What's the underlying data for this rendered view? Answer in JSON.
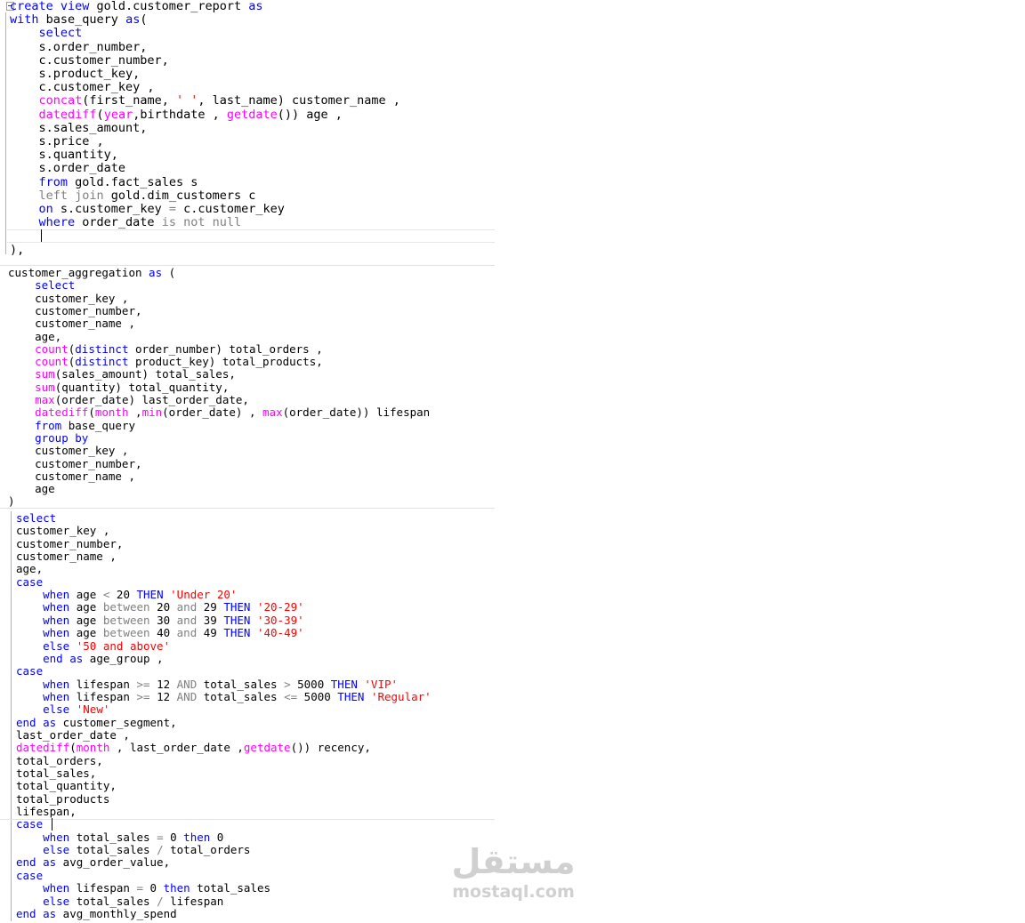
{
  "editor": {
    "language": "sql",
    "palette": {
      "keyword": "#0000ff",
      "function": "#ff00ff",
      "string": "#ff0000",
      "operator": "#808080",
      "text": "#000000",
      "background": "#ffffff"
    },
    "panels": [
      {
        "id": "p1",
        "lines": [
          [
            [
              "kw",
              "create view"
            ],
            [
              "",
              " gold.customer_report "
            ],
            [
              "kw",
              "as"
            ]
          ],
          [
            [
              "kw",
              "with"
            ],
            [
              "",
              " base_query "
            ],
            [
              "kw",
              "as"
            ],
            [
              "",
              "("
            ]
          ],
          [
            [
              "",
              "    "
            ],
            [
              "kw",
              "select"
            ]
          ],
          [
            [
              "",
              "    s.order_number,"
            ]
          ],
          [
            [
              "",
              "    c.customer_number,"
            ]
          ],
          [
            [
              "",
              "    s.product_key,"
            ]
          ],
          [
            [
              "",
              "    c.customer_key ,"
            ]
          ],
          [
            [
              "",
              "    "
            ],
            [
              "fn",
              "concat"
            ],
            [
              "",
              "(first_name, "
            ],
            [
              "str",
              "' '"
            ],
            [
              "",
              ", last_name) customer_name ,"
            ]
          ],
          [
            [
              "",
              "    "
            ],
            [
              "fn",
              "datediff"
            ],
            [
              "",
              "("
            ],
            [
              "fn",
              "year"
            ],
            [
              "",
              ",birthdate , "
            ],
            [
              "fn",
              "getdate"
            ],
            [
              "",
              "()) age ,"
            ]
          ],
          [
            [
              "",
              "    s.sales_amount,"
            ]
          ],
          [
            [
              "",
              "    s.price ,"
            ]
          ],
          [
            [
              "",
              "    s.quantity,"
            ]
          ],
          [
            [
              "",
              "    s.order_date"
            ]
          ],
          [
            [
              "",
              "    "
            ],
            [
              "kw",
              "from"
            ],
            [
              "",
              " gold.fact_sales s"
            ]
          ],
          [
            [
              "",
              "    "
            ],
            [
              "op",
              "left join"
            ],
            [
              "",
              " gold.dim_customers c"
            ]
          ],
          [
            [
              "",
              "    "
            ],
            [
              "kw",
              "on"
            ],
            [
              "",
              " s.customer_key "
            ],
            [
              "op",
              "="
            ],
            [
              "",
              " c.customer_key"
            ]
          ],
          [
            [
              "",
              "    "
            ],
            [
              "kw",
              "where"
            ],
            [
              "",
              " order_date "
            ],
            [
              "op",
              "is not null"
            ]
          ],
          [
            [
              "",
              ""
            ]
          ],
          [
            [
              "",
              "),"
            ]
          ]
        ]
      },
      {
        "id": "p2",
        "lines": [
          [
            [
              "",
              "customer_aggregation "
            ],
            [
              "kw",
              "as"
            ],
            [
              "",
              " ("
            ]
          ],
          [
            [
              "",
              "    "
            ],
            [
              "kw",
              "select"
            ]
          ],
          [
            [
              "",
              "    customer_key ,"
            ]
          ],
          [
            [
              "",
              "    customer_number,"
            ]
          ],
          [
            [
              "",
              "    customer_name ,"
            ]
          ],
          [
            [
              "",
              "    age,"
            ]
          ],
          [
            [
              "",
              "    "
            ],
            [
              "fn",
              "count"
            ],
            [
              "",
              "("
            ],
            [
              "kw",
              "distinct"
            ],
            [
              "",
              " order_number) total_orders ,"
            ]
          ],
          [
            [
              "",
              "    "
            ],
            [
              "fn",
              "count"
            ],
            [
              "",
              "("
            ],
            [
              "kw",
              "distinct"
            ],
            [
              "",
              " product_key) total_products,"
            ]
          ],
          [
            [
              "",
              "    "
            ],
            [
              "fn",
              "sum"
            ],
            [
              "",
              "(sales_amount) total_sales,"
            ]
          ],
          [
            [
              "",
              "    "
            ],
            [
              "fn",
              "sum"
            ],
            [
              "",
              "(quantity) total_quantity,"
            ]
          ],
          [
            [
              "",
              "    "
            ],
            [
              "fn",
              "max"
            ],
            [
              "",
              "(order_date) last_order_date,"
            ]
          ],
          [
            [
              "",
              "    "
            ],
            [
              "fn",
              "datediff"
            ],
            [
              "",
              "("
            ],
            [
              "fn",
              "month"
            ],
            [
              "",
              " ,"
            ],
            [
              "fn",
              "min"
            ],
            [
              "",
              "(order_date) , "
            ],
            [
              "fn",
              "max"
            ],
            [
              "",
              "(order_date)) lifespan"
            ]
          ],
          [
            [
              "",
              "    "
            ],
            [
              "kw",
              "from"
            ],
            [
              "",
              " base_query"
            ]
          ],
          [
            [
              "",
              "    "
            ],
            [
              "kw",
              "group by"
            ]
          ],
          [
            [
              "",
              "    customer_key ,"
            ]
          ],
          [
            [
              "",
              "    customer_number,"
            ]
          ],
          [
            [
              "",
              "    customer_name ,"
            ]
          ],
          [
            [
              "",
              "    age"
            ]
          ],
          [
            [
              "",
              ")"
            ]
          ]
        ]
      },
      {
        "id": "p3",
        "lines": [
          [
            [
              "kw",
              "select"
            ]
          ],
          [
            [
              "",
              "customer_key ,"
            ]
          ],
          [
            [
              "",
              "customer_number,"
            ]
          ],
          [
            [
              "",
              "customer_name ,"
            ]
          ],
          [
            [
              "",
              "age,"
            ]
          ],
          [
            [
              "kw",
              "case"
            ]
          ],
          [
            [
              "",
              "    "
            ],
            [
              "kw",
              "when"
            ],
            [
              "",
              " age "
            ],
            [
              "op",
              "<"
            ],
            [
              "",
              " 20 "
            ],
            [
              "kw",
              "THEN"
            ],
            [
              "",
              " "
            ],
            [
              "str",
              "'Under 20'"
            ]
          ],
          [
            [
              "",
              "    "
            ],
            [
              "kw",
              "when"
            ],
            [
              "",
              " age "
            ],
            [
              "op",
              "between"
            ],
            [
              "",
              " 20 "
            ],
            [
              "op",
              "and"
            ],
            [
              "",
              " 29 "
            ],
            [
              "kw",
              "THEN"
            ],
            [
              "",
              " "
            ],
            [
              "str",
              "'20-29'"
            ]
          ],
          [
            [
              "",
              "    "
            ],
            [
              "kw",
              "when"
            ],
            [
              "",
              " age "
            ],
            [
              "op",
              "between"
            ],
            [
              "",
              " 30 "
            ],
            [
              "op",
              "and"
            ],
            [
              "",
              " 39 "
            ],
            [
              "kw",
              "THEN"
            ],
            [
              "",
              " "
            ],
            [
              "str",
              "'30-39'"
            ]
          ],
          [
            [
              "",
              "    "
            ],
            [
              "kw",
              "when"
            ],
            [
              "",
              " age "
            ],
            [
              "op",
              "between"
            ],
            [
              "",
              " 40 "
            ],
            [
              "op",
              "and"
            ],
            [
              "",
              " 49 "
            ],
            [
              "kw",
              "THEN"
            ],
            [
              "",
              " "
            ],
            [
              "str",
              "'40-49'"
            ]
          ],
          [
            [
              "",
              "    "
            ],
            [
              "kw",
              "else"
            ],
            [
              "",
              " "
            ],
            [
              "str",
              "'50 and above'"
            ]
          ],
          [
            [
              "",
              "    "
            ],
            [
              "kw",
              "end as"
            ],
            [
              "",
              " age_group ,"
            ]
          ],
          [
            [
              "kw",
              "case"
            ]
          ],
          [
            [
              "",
              "    "
            ],
            [
              "kw",
              "when"
            ],
            [
              "",
              " lifespan "
            ],
            [
              "op",
              ">="
            ],
            [
              "",
              " 12 "
            ],
            [
              "op",
              "AND"
            ],
            [
              "",
              " total_sales "
            ],
            [
              "op",
              ">"
            ],
            [
              "",
              " 5000 "
            ],
            [
              "kw",
              "THEN"
            ],
            [
              "",
              " "
            ],
            [
              "str",
              "'VIP'"
            ]
          ],
          [
            [
              "",
              "    "
            ],
            [
              "kw",
              "when"
            ],
            [
              "",
              " lifespan "
            ],
            [
              "op",
              ">="
            ],
            [
              "",
              " 12 "
            ],
            [
              "op",
              "AND"
            ],
            [
              "",
              " total_sales "
            ],
            [
              "op",
              "<="
            ],
            [
              "",
              " 5000 "
            ],
            [
              "kw",
              "THEN"
            ],
            [
              "",
              " "
            ],
            [
              "str",
              "'Regular'"
            ]
          ],
          [
            [
              "",
              "    "
            ],
            [
              "kw",
              "else"
            ],
            [
              "",
              " "
            ],
            [
              "str",
              "'New'"
            ]
          ],
          [
            [
              "kw",
              "end as"
            ],
            [
              "",
              " customer_segment,"
            ]
          ],
          [
            [
              "",
              "last_order_date ,"
            ]
          ],
          [
            [
              "fn",
              "datediff"
            ],
            [
              "",
              "("
            ],
            [
              "fn",
              "month"
            ],
            [
              "",
              " , last_order_date ,"
            ],
            [
              "fn",
              "getdate"
            ],
            [
              "",
              "()) recency,"
            ]
          ],
          [
            [
              "",
              "total_orders,"
            ]
          ],
          [
            [
              "",
              "total_sales,"
            ]
          ],
          [
            [
              "",
              "total_quantity,"
            ]
          ],
          [
            [
              "",
              "total_products"
            ]
          ],
          [
            [
              "",
              "lifespan,"
            ]
          ],
          [
            [
              "kw",
              "case"
            ]
          ],
          [
            [
              "",
              "    "
            ],
            [
              "kw",
              "when"
            ],
            [
              "",
              " total_sales "
            ],
            [
              "op",
              "="
            ],
            [
              "",
              " 0 "
            ],
            [
              "kw",
              "then"
            ],
            [
              "",
              " 0"
            ]
          ],
          [
            [
              "",
              "    "
            ],
            [
              "kw",
              "else"
            ],
            [
              "",
              " total_sales "
            ],
            [
              "op",
              "/"
            ],
            [
              "",
              " total_orders"
            ]
          ],
          [
            [
              "kw",
              "end as"
            ],
            [
              "",
              " avg_order_value,"
            ]
          ],
          [
            [
              "kw",
              "case"
            ]
          ],
          [
            [
              "",
              "    "
            ],
            [
              "kw",
              "when"
            ],
            [
              "",
              " lifespan "
            ],
            [
              "op",
              "="
            ],
            [
              "",
              " 0 "
            ],
            [
              "kw",
              "then"
            ],
            [
              "",
              " total_sales"
            ]
          ],
          [
            [
              "",
              "    "
            ],
            [
              "kw",
              "else"
            ],
            [
              "",
              " total_sales "
            ],
            [
              "op",
              "/"
            ],
            [
              "",
              " lifespan"
            ]
          ],
          [
            [
              "kw",
              "end as"
            ],
            [
              "",
              " avg_monthly_spend"
            ]
          ]
        ]
      }
    ]
  },
  "watermark": {
    "arabic": "مستقل",
    "latin": "mostaql.com"
  }
}
